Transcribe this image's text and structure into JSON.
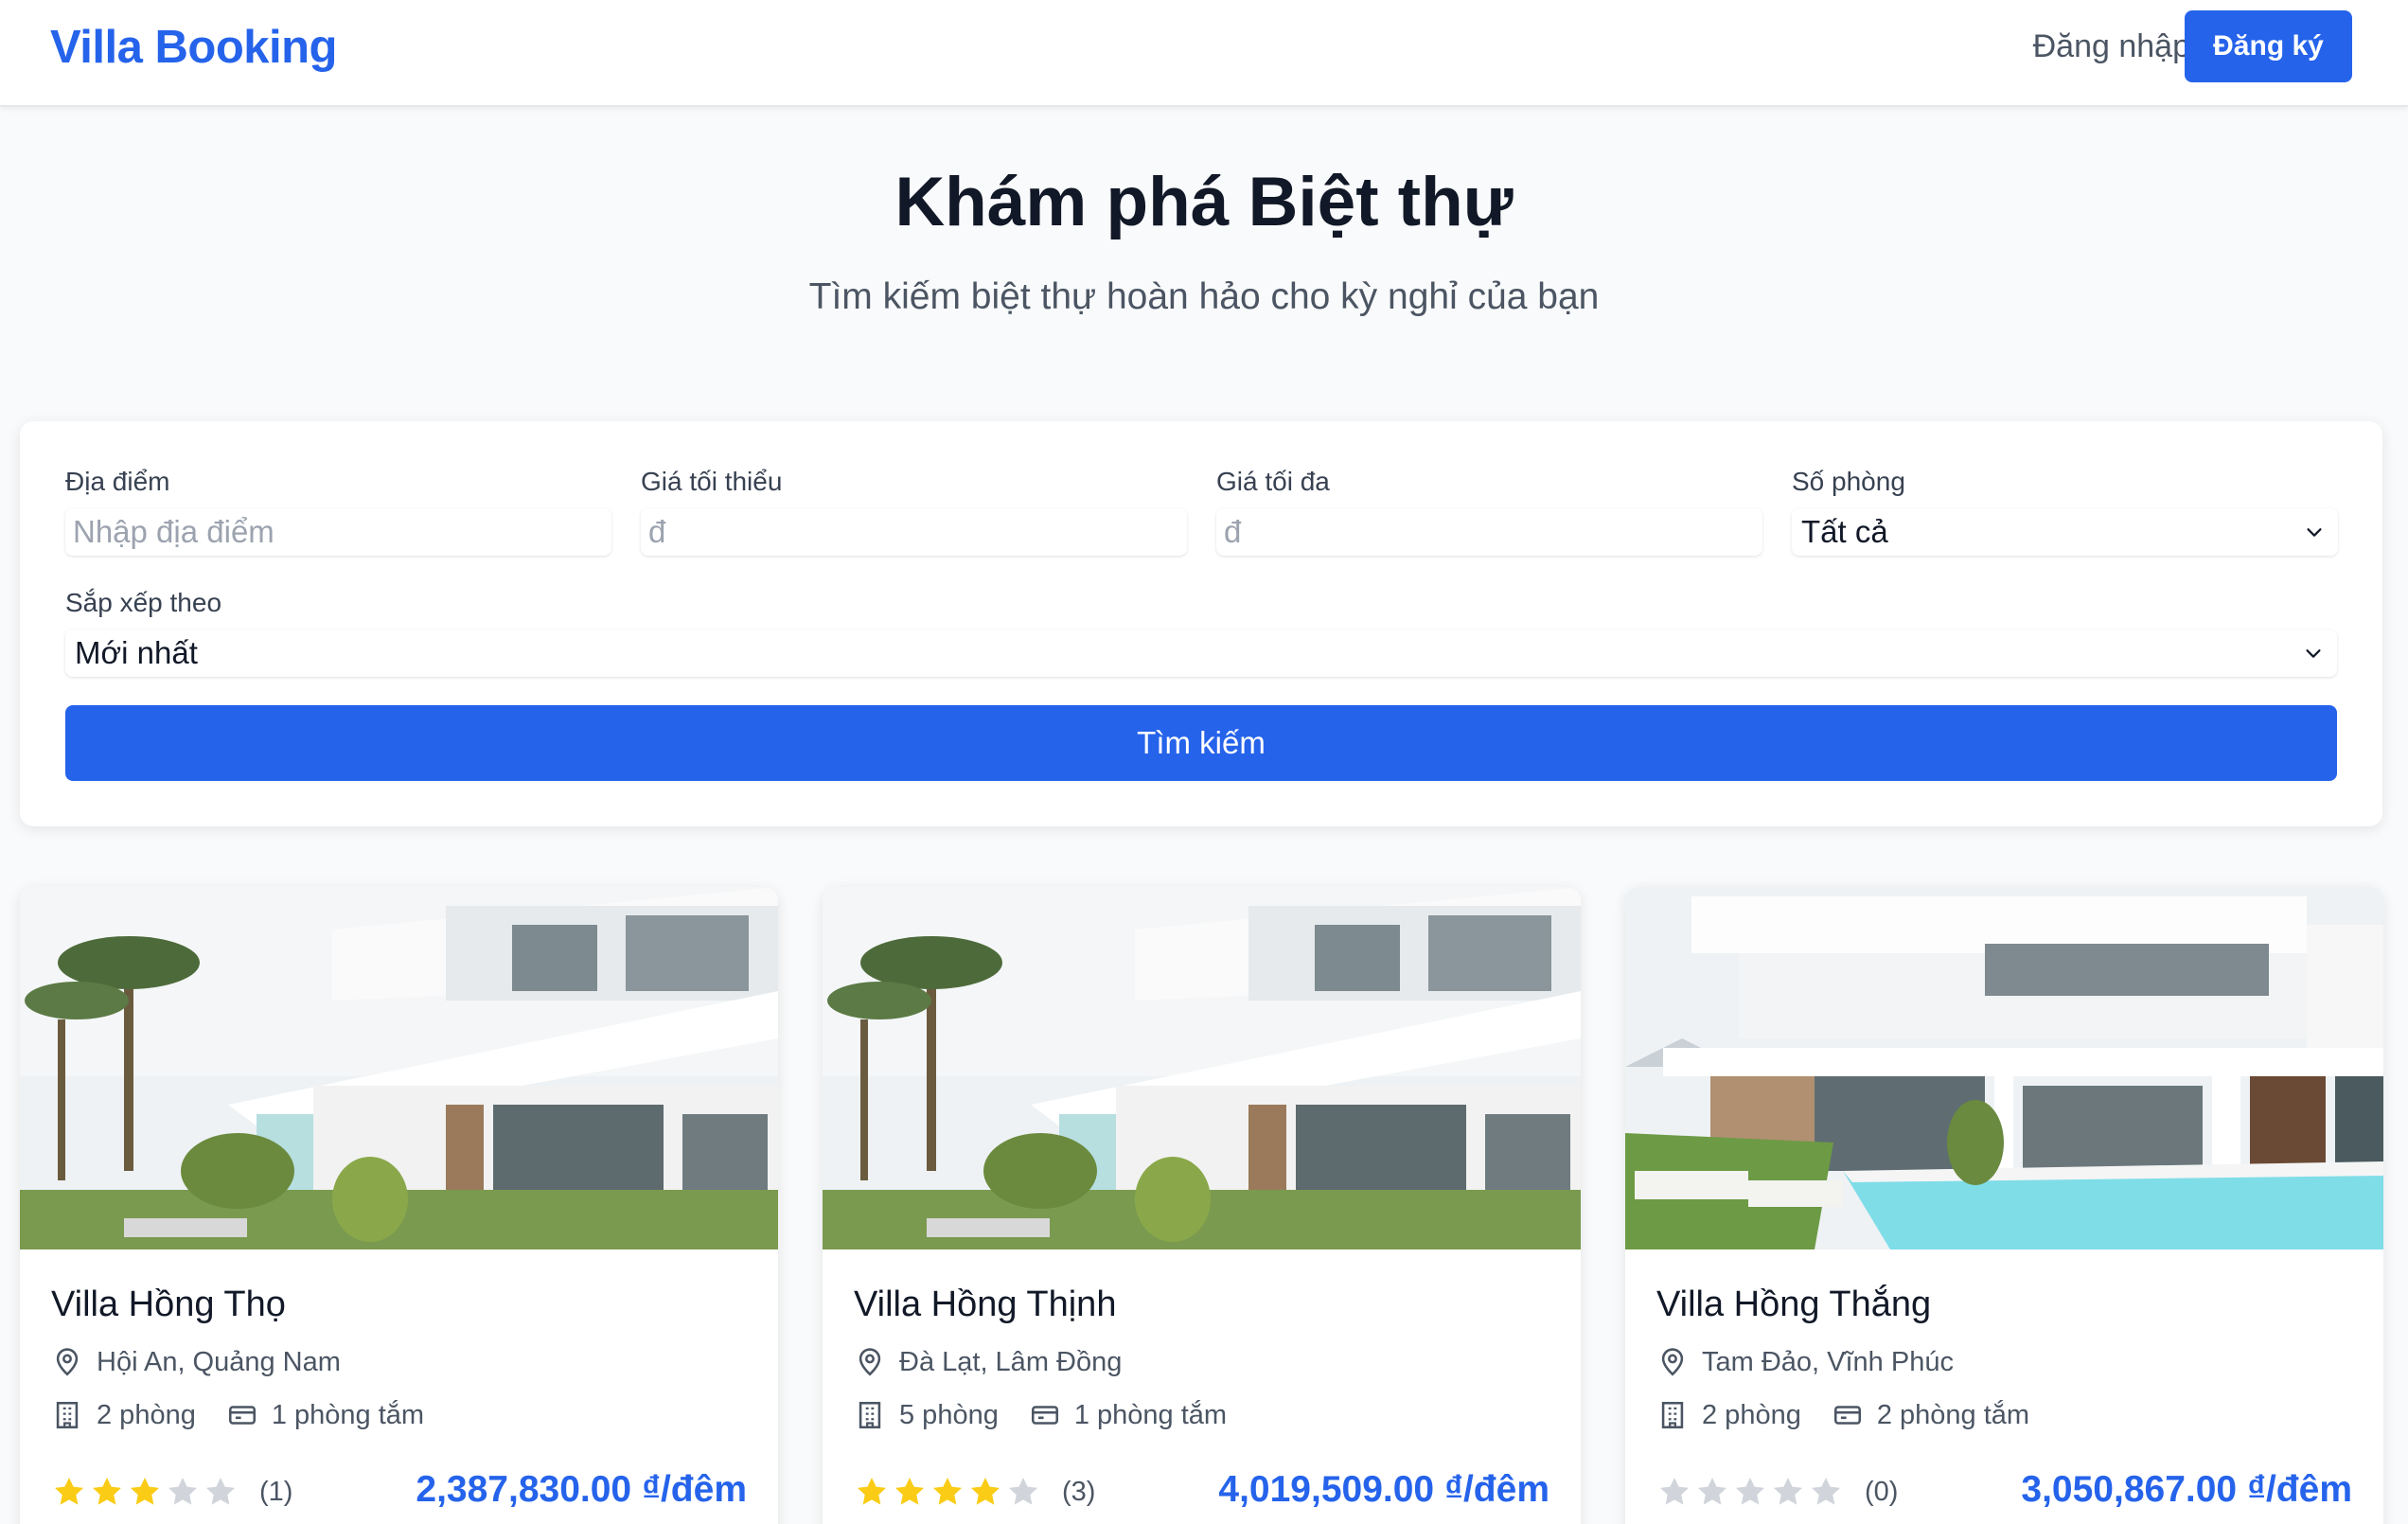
{
  "header": {
    "brand": "Villa Booking",
    "login_label": "Đăng nhập",
    "signup_label": "Đăng ký"
  },
  "hero": {
    "title": "Khám phá Biệt thự",
    "subtitle": "Tìm kiếm biệt thự hoàn hảo cho kỳ nghỉ của bạn"
  },
  "filters": {
    "location": {
      "label": "Địa điểm",
      "placeholder": "Nhập địa điểm"
    },
    "min_price": {
      "label": "Giá tối thiểu",
      "placeholder": "đ"
    },
    "max_price": {
      "label": "Giá tối đa",
      "placeholder": "đ"
    },
    "rooms": {
      "label": "Số phòng",
      "value": "Tất cả"
    },
    "sort": {
      "label": "Sắp xếp theo",
      "value": "Mới nhất"
    },
    "search_label": "Tìm kiếm"
  },
  "villas": [
    {
      "name": "Villa Hồng Thọ",
      "location": "Hội An, Quảng Nam",
      "rooms": "2 phòng",
      "bathrooms": "1 phòng tắm",
      "rating": 3,
      "reviews": "(1)",
      "price": "2,387,830.00 ₫/đêm"
    },
    {
      "name": "Villa Hồng Thịnh",
      "location": "Đà Lạt, Lâm Đồng",
      "rooms": "5 phòng",
      "bathrooms": "1 phòng tắm",
      "rating": 4,
      "reviews": "(3)",
      "price": "4,019,509.00 ₫/đêm"
    },
    {
      "name": "Villa Hồng Thắng",
      "location": "Tam Đảo, Vĩnh Phúc",
      "rooms": "2 phòng",
      "bathrooms": "2 phòng tắm",
      "rating": 0,
      "reviews": "(0)",
      "price": "3,050,867.00 ₫/đêm"
    }
  ],
  "colors": {
    "accent": "#2563eb",
    "star_filled": "#facc15",
    "star_empty": "#d1d5db"
  }
}
